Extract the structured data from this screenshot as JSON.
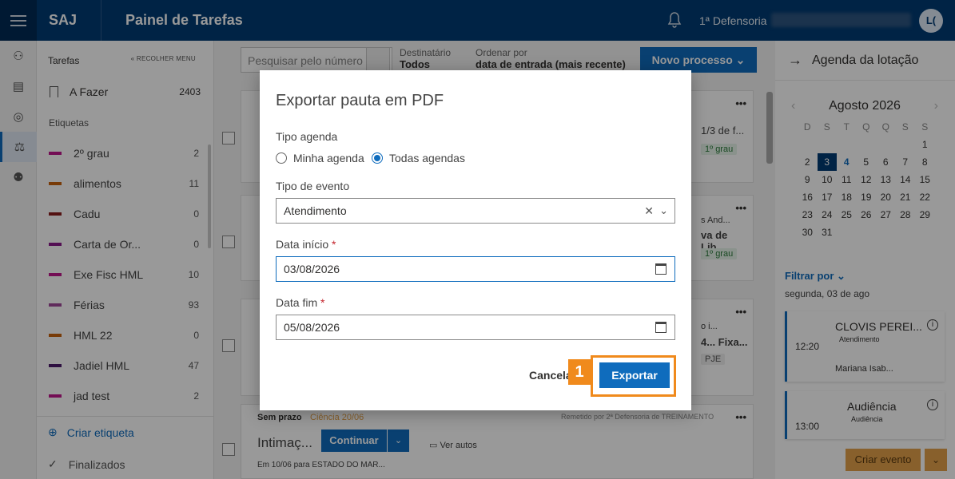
{
  "topbar": {
    "logo": "SAJ",
    "title": "Painel de Tarefas",
    "defensoria": "1ª Defensoria",
    "avatar": "L("
  },
  "left": {
    "header": "Tarefas",
    "collapse": "« RECOLHER MENU",
    "afazer": {
      "label": "A Fazer",
      "count": "2403"
    },
    "etiquetas_label": "Etiquetas",
    "tags": [
      {
        "name": "2º grau",
        "count": "2",
        "color": "#c0168c"
      },
      {
        "name": "alimentos",
        "count": "11",
        "color": "#c8630e"
      },
      {
        "name": "Cadu",
        "count": "0",
        "color": "#8b1d1d"
      },
      {
        "name": "Carta de Or...",
        "count": "0",
        "color": "#8b1a8b"
      },
      {
        "name": "Exe Fisc HML",
        "count": "10",
        "color": "#c0168c"
      },
      {
        "name": "Férias",
        "count": "93",
        "color": "#a0489a"
      },
      {
        "name": "HML 22",
        "count": "0",
        "color": "#c8630e"
      },
      {
        "name": "Jadiel HML",
        "count": "47",
        "color": "#4b1a6b"
      },
      {
        "name": "jad test",
        "count": "2",
        "color": "#c0168c"
      }
    ],
    "criar": "Criar etiqueta",
    "finalizados": "Finalizados"
  },
  "center": {
    "search_placeholder": "Pesquisar pelo número",
    "dest_label": "Destinatário",
    "dest_value": "Todos",
    "ordem_label": "Ordenar por",
    "ordem_value": "data de entrada (mais recente)",
    "novo": "Novo processo",
    "card1": {
      "snippet": "1/3 de f...",
      "grau": "1º grau"
    },
    "card2": {
      "snippet1": "s And...",
      "snippet2": "va de Lib...",
      "grau": "1º grau"
    },
    "card3": {
      "snippet1": "o i...",
      "snippet2": "4... Fixa...",
      "tag": "PJE"
    },
    "card4": {
      "prazo": "Sem prazo",
      "ciencia": "Ciência 20/06",
      "remetido": "Remetido por 2ª Defensoria de TREINAMENTO",
      "title": "Intimaç...",
      "continuar": "Continuar",
      "ver": "Ver autos",
      "em": "Em 10/06 para ESTADO DO MAR..."
    }
  },
  "right": {
    "title": "Agenda da lotação",
    "month": "Agosto 2026",
    "dows": [
      "D",
      "S",
      "T",
      "Q",
      "Q",
      "S",
      "S"
    ],
    "days": [
      "",
      "",
      "",
      "",
      "",
      "",
      "1",
      "2",
      "3",
      "4",
      "5",
      "6",
      "7",
      "8",
      "9",
      "10",
      "11",
      "12",
      "13",
      "14",
      "15",
      "16",
      "17",
      "18",
      "19",
      "20",
      "21",
      "22",
      "23",
      "24",
      "25",
      "26",
      "27",
      "28",
      "29",
      "30",
      "31"
    ],
    "filtrar": "Filtrar por",
    "segunda": "segunda, 03 de ago",
    "events": [
      {
        "time": "12:20",
        "name": "CLOVIS PEREI...",
        "sub": "Atendimento",
        "person": "Mariana Isab..."
      },
      {
        "time": "13:00",
        "name": "Audiência",
        "sub": "Audiência"
      }
    ],
    "criar_evento": "Criar evento"
  },
  "modal": {
    "title": "Exportar pauta em PDF",
    "tipo_agenda": "Tipo agenda",
    "opt1": "Minha agenda",
    "opt2": "Todas agendas",
    "tipo_evento": "Tipo de evento",
    "tipo_evento_value": "Atendimento",
    "data_inicio": "Data início",
    "data_inicio_value": "03/08/2026",
    "data_fim": "Data fim",
    "data_fim_value": "05/08/2026",
    "required": "*",
    "cancel": "Cancela",
    "export": "Exportar",
    "step": "1"
  }
}
